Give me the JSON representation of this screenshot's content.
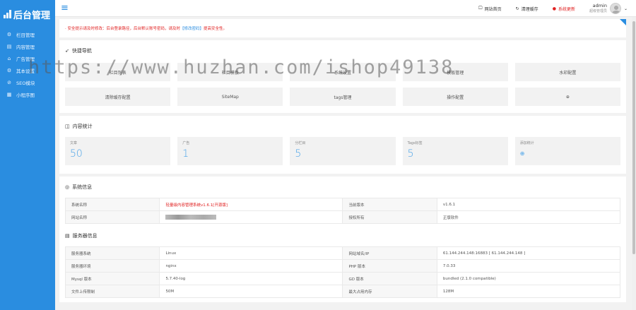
{
  "sidebar": {
    "logo": "后台管理",
    "items": [
      {
        "icon": "gear-icon",
        "glyph": "⚙",
        "label": "栏目管理"
      },
      {
        "icon": "document-icon",
        "glyph": "▤",
        "label": "内容管理"
      },
      {
        "icon": "home-icon",
        "glyph": "⌂",
        "label": "广告管理"
      },
      {
        "icon": "settings-icon",
        "glyph": "⚙",
        "label": "其本设置"
      },
      {
        "icon": "seo-icon",
        "glyph": "⊘",
        "label": "SEO模块"
      },
      {
        "icon": "grid-icon",
        "glyph": "▦",
        "label": "小程序图"
      }
    ]
  },
  "topbar": {
    "menu_glyph": "≡",
    "website_home": "网站首页",
    "clear_cache": "清理缓存",
    "system_update": "系统更新",
    "username": "admin",
    "role": "超级管理员"
  },
  "notice": {
    "text_before": "· 安全提示请及时修改：后台登录路径，后台默认账号密码，请及时",
    "link": "【修改密码】",
    "text_after": "提高安全性。"
  },
  "quick_nav": {
    "title": "快捷导航",
    "items": [
      "栏目列表",
      "栏目模板",
      "系统设置",
      "模板管理",
      "水印配置",
      "清除缓存配置",
      "SiteMap",
      "tags管理",
      "操作配置",
      "⊕"
    ]
  },
  "stats": {
    "title": "内容统计",
    "items": [
      {
        "label": "文章",
        "value": "50"
      },
      {
        "label": "广告",
        "value": "1"
      },
      {
        "label": "分栏目",
        "value": "5"
      },
      {
        "label": "Tags标签",
        "value": "5"
      },
      {
        "label": "添加统计",
        "value": "⊕"
      }
    ]
  },
  "system_info": {
    "title": "系统信息",
    "rows": [
      {
        "l1": "系统名称",
        "v1": "轻量级内容管理系统v1.6.1[开源版]",
        "l2": "当前版本",
        "v2": "v1.6.1"
      },
      {
        "l1": "网站名称",
        "v1": "",
        "l2": "授权所有",
        "v2": "正版软件"
      }
    ]
  },
  "server_info": {
    "title": "服务器信息",
    "rows": [
      {
        "l1": "服务器系统",
        "v1": "Linux",
        "l2": "网站域名/IP",
        "v2": "61.144.244.148:16883 [ 61.144.244.148 ]"
      },
      {
        "l1": "服务器环境",
        "v1": "nginx",
        "l2": "PHP 版本",
        "v2": "7.0.33"
      },
      {
        "l1": "Mysql 版本",
        "v1": "5.7.40-log",
        "l2": "GD 版本",
        "v2": "bundled (2.1.0 compatible)"
      },
      {
        "l1": "文件上传限制",
        "v1": "50M",
        "l2": "最大占用内存",
        "v2": "128M"
      }
    ]
  },
  "watermark": "https://www.huzhan.com/ishop49138"
}
